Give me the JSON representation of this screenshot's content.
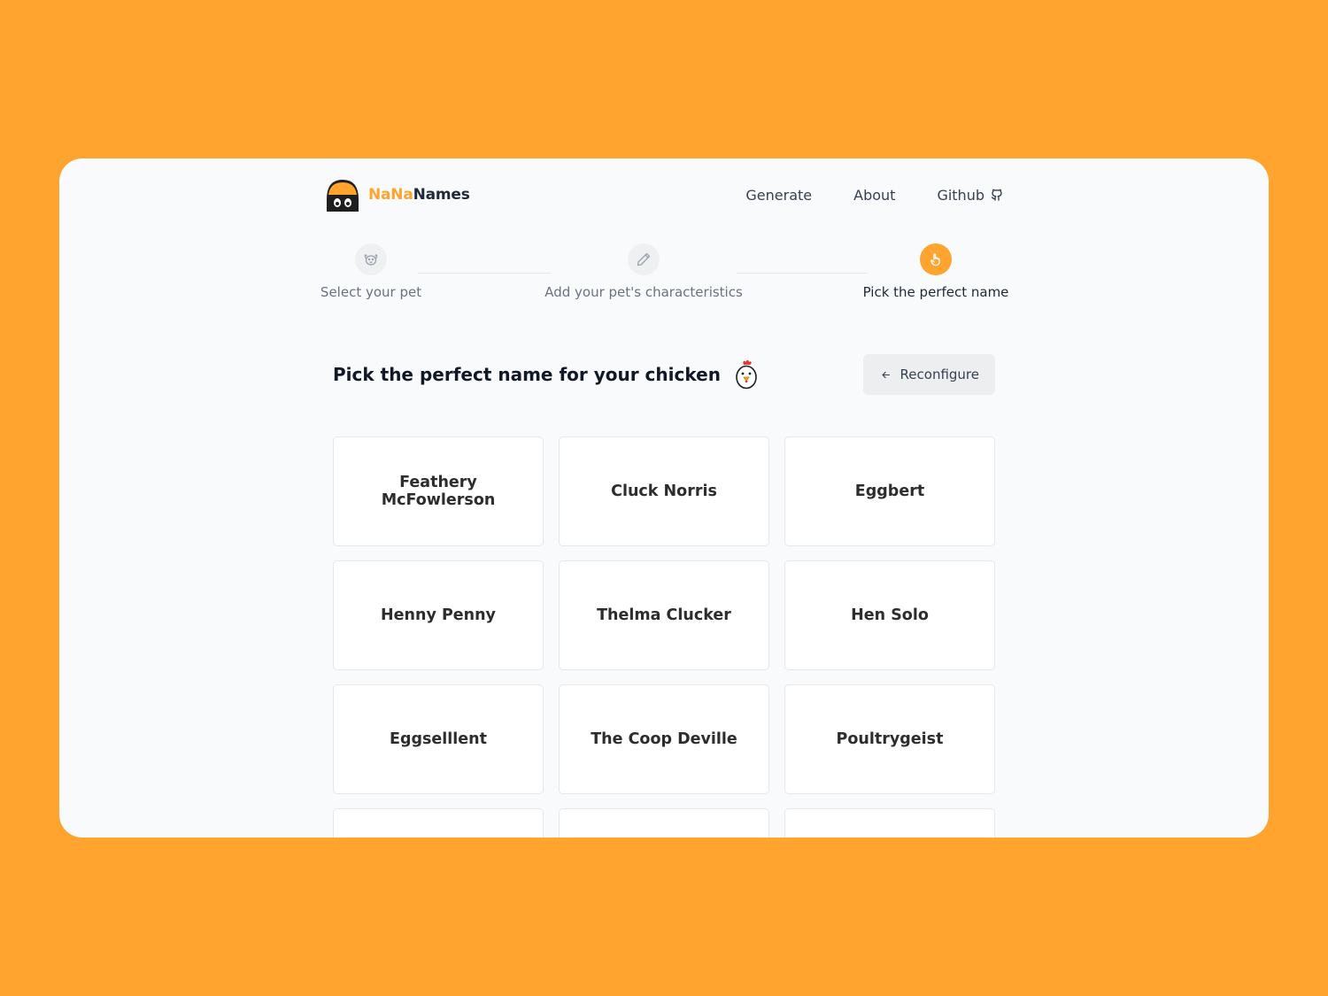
{
  "header": {
    "brand_part1": "NaNa",
    "brand_part2": "Names",
    "nav": [
      {
        "label": "Generate"
      },
      {
        "label": "About"
      },
      {
        "label": "Github",
        "icon": "github-icon"
      }
    ]
  },
  "stepper": {
    "steps": [
      {
        "label": "Select your pet",
        "icon": "pet-icon",
        "state": "completed"
      },
      {
        "label": "Add your pet's characteristics",
        "icon": "pencil-icon",
        "state": "completed"
      },
      {
        "label": "Pick the perfect name",
        "icon": "pointer-hand-icon",
        "state": "active"
      }
    ]
  },
  "main": {
    "title": "Pick the perfect name for your chicken",
    "title_icon": "chicken-icon",
    "reconfigure_label": "Reconfigure",
    "names": [
      "Feathery McFowlerson",
      "Cluck Norris",
      "Eggbert",
      "Henny Penny",
      "Thelma Clucker",
      "Hen Solo",
      "Eggselllent",
      "The Coop Deville",
      "Poultrygeist",
      "",
      "",
      ""
    ]
  },
  "colors": {
    "background": "#FFA42E",
    "accent": "#FFA42E",
    "surface": "#F8FAFC",
    "card": "#FFFFFF",
    "text": "#111827"
  }
}
